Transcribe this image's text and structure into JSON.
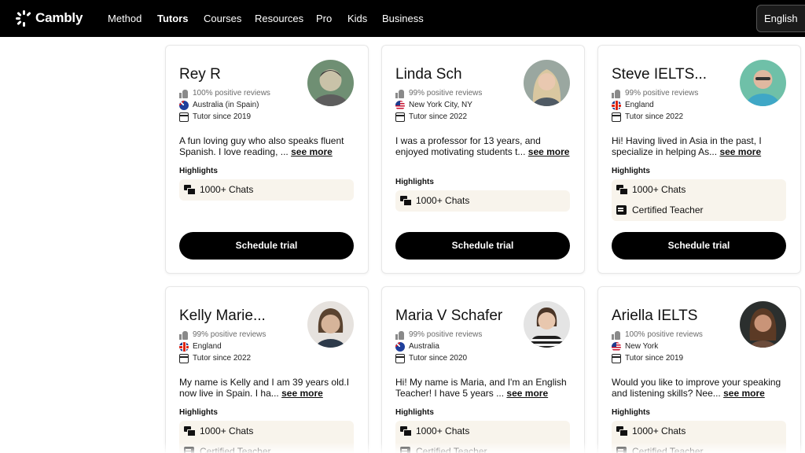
{
  "nav": {
    "brand": "Cambly",
    "links": [
      "Method",
      "Tutors",
      "Courses",
      "Resources",
      "Pro",
      "Kids",
      "Business"
    ],
    "active": "Tutors",
    "language": "English"
  },
  "labels": {
    "highlights": "Highlights",
    "schedule": "Schedule trial",
    "see_more": "see more"
  },
  "tutors": [
    {
      "name": "Rey R",
      "reviews": "100% positive reviews",
      "location": "Australia (in Spain)",
      "flag": "au",
      "since": "Tutor since 2019",
      "bio": "A fun loving guy who also speaks fluent Spanish. I love reading, ...",
      "highlights": [
        "1000+ Chats"
      ],
      "avatar_colors": [
        "#c9c2a8",
        "#6f8f73"
      ]
    },
    {
      "name": "Linda Sch",
      "reviews": "99% positive reviews",
      "location": "New York City, NY",
      "flag": "us",
      "since": "Tutor since 2022",
      "bio": "I was a professor for 13 years, and enjoyed motivating students t...",
      "highlights": [
        "1000+ Chats"
      ],
      "avatar_colors": [
        "#d9c7a0",
        "#4f5a64"
      ]
    },
    {
      "name": "Steve IELTS...",
      "reviews": "99% positive reviews",
      "location": "England",
      "flag": "uk",
      "since": "Tutor since 2022",
      "bio": "Hi! Having lived in Asia in the past, I specialize in helping As...",
      "highlights": [
        "1000+ Chats",
        "Certified Teacher"
      ],
      "avatar_colors": [
        "#e0b8a0",
        "#3fa7c6"
      ]
    },
    {
      "name": "Kelly Marie...",
      "reviews": "99% positive reviews",
      "location": "England",
      "flag": "uk",
      "since": "Tutor since 2022",
      "bio": "My name is Kelly and I am 39 years old.I now live in Spain. I ha...",
      "highlights": [
        "1000+ Chats",
        "Certified Teacher"
      ],
      "avatar_colors": [
        "#d6b49a",
        "#e6e2de"
      ]
    },
    {
      "name": "Maria V Schafer",
      "reviews": "99% positive reviews",
      "location": "Australia",
      "flag": "au",
      "since": "Tutor since 2020",
      "bio": "Hi! My name is Maria, and I'm an English Teacher! I have 5 years ...",
      "highlights": [
        "1000+ Chats",
        "Certified Teacher"
      ],
      "avatar_colors": [
        "#e8c7ae",
        "#f0f0f0"
      ]
    },
    {
      "name": "Ariella IELTS",
      "reviews": "100% positive reviews",
      "location": "New York",
      "flag": "us",
      "since": "Tutor since 2019",
      "bio": "Would you like to improve your speaking and listening skills? Nee...",
      "highlights": [
        "1000+ Chats",
        "Certified Teacher"
      ],
      "avatar_colors": [
        "#c99478",
        "#2b2f2e"
      ]
    }
  ]
}
